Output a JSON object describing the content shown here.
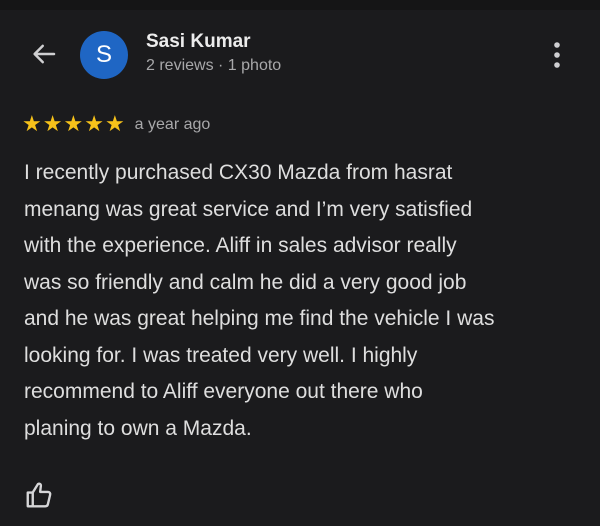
{
  "header": {
    "back_icon": "arrow-left-icon",
    "avatar_letter": "S",
    "reviewer_name": "Sasi Kumar",
    "reviewer_meta": "2 reviews · 1 photo",
    "more_icon": "more-vert-icon"
  },
  "review": {
    "rating": 5,
    "rating_max": 5,
    "stars": [
      "★",
      "★",
      "★",
      "★",
      "★"
    ],
    "time": "a year ago",
    "lines": [
      "I recently purchased CX30 Mazda from hasrat",
      "menang was great service and I’m very satisfied",
      "with the experience. Aliff in sales advisor really",
      "was so friendly and calm he did a very good job",
      "and he was great helping me find the vehicle I was",
      "looking for. I was treated very well. I highly",
      "recommend to Aliff everyone out there who",
      "planing to own a Mazda."
    ],
    "like_icon": "thumb-up-icon"
  },
  "colors": {
    "background": "#1b1b1d",
    "avatar": "#1f66c4",
    "star": "#f7c21a",
    "primary_text": "#ececec",
    "secondary_text": "#a8a8aa"
  }
}
